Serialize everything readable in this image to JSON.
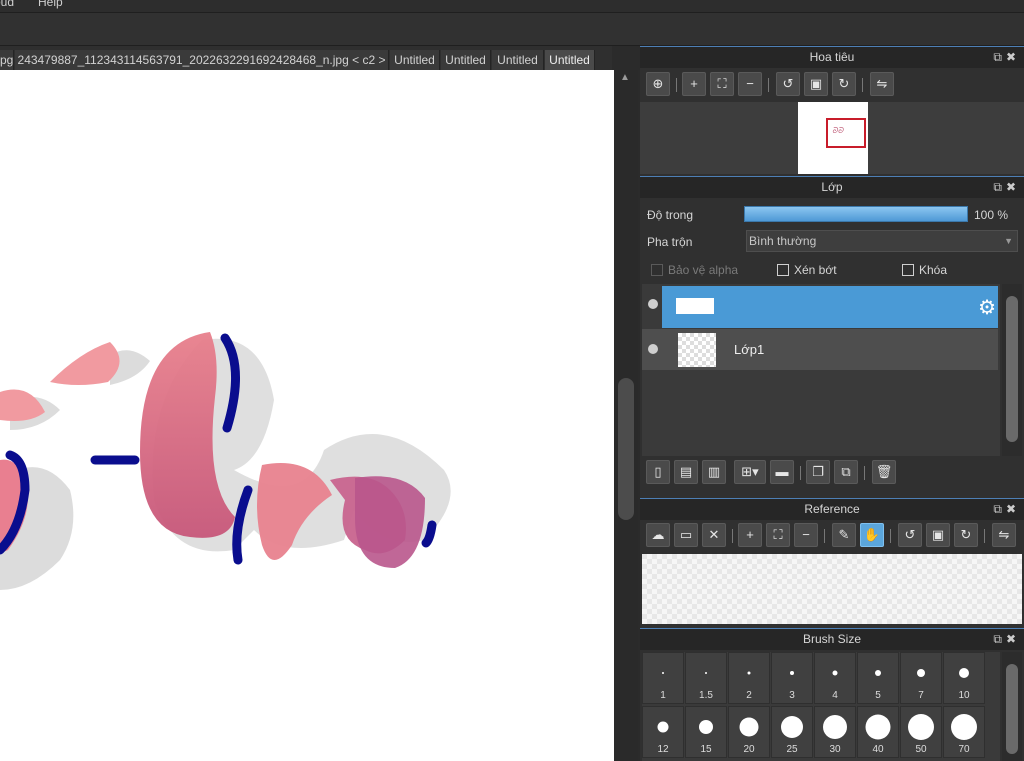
{
  "menu": {
    "items": [
      "oud",
      "Help"
    ]
  },
  "tabs": [
    {
      "label": "pg"
    },
    {
      "label": "243479887_112343114563791_2022632291692428468_n.jpg < c2 >"
    },
    {
      "label": "Untitled"
    },
    {
      "label": "Untitled"
    },
    {
      "label": "Untitled"
    },
    {
      "label": "Untitled"
    }
  ],
  "navigator": {
    "title": "Hoa tiêu"
  },
  "layers_panel": {
    "title": "Lớp",
    "opacity_label": "Độ trong",
    "opacity_value": "100 %",
    "opacity": 1.0,
    "blend_label": "Pha trộn",
    "blend_value": "Bình thường",
    "protect_alpha": "Bảo vệ alpha",
    "clipping": "Xén bớt",
    "lock": "Khóa",
    "layers": [
      {
        "name": "",
        "selected": true
      },
      {
        "name": "Lớp1",
        "selected": false
      }
    ]
  },
  "reference": {
    "title": "Reference"
  },
  "brush_size": {
    "title": "Brush Size",
    "sizes": [
      "1",
      "1.5",
      "2",
      "3",
      "4",
      "5",
      "7",
      "10",
      "12",
      "15",
      "20",
      "25",
      "30",
      "40",
      "50",
      "70"
    ]
  },
  "colors": {
    "accent": "#4a9ad6",
    "selection_frame": "#c81c2a"
  }
}
